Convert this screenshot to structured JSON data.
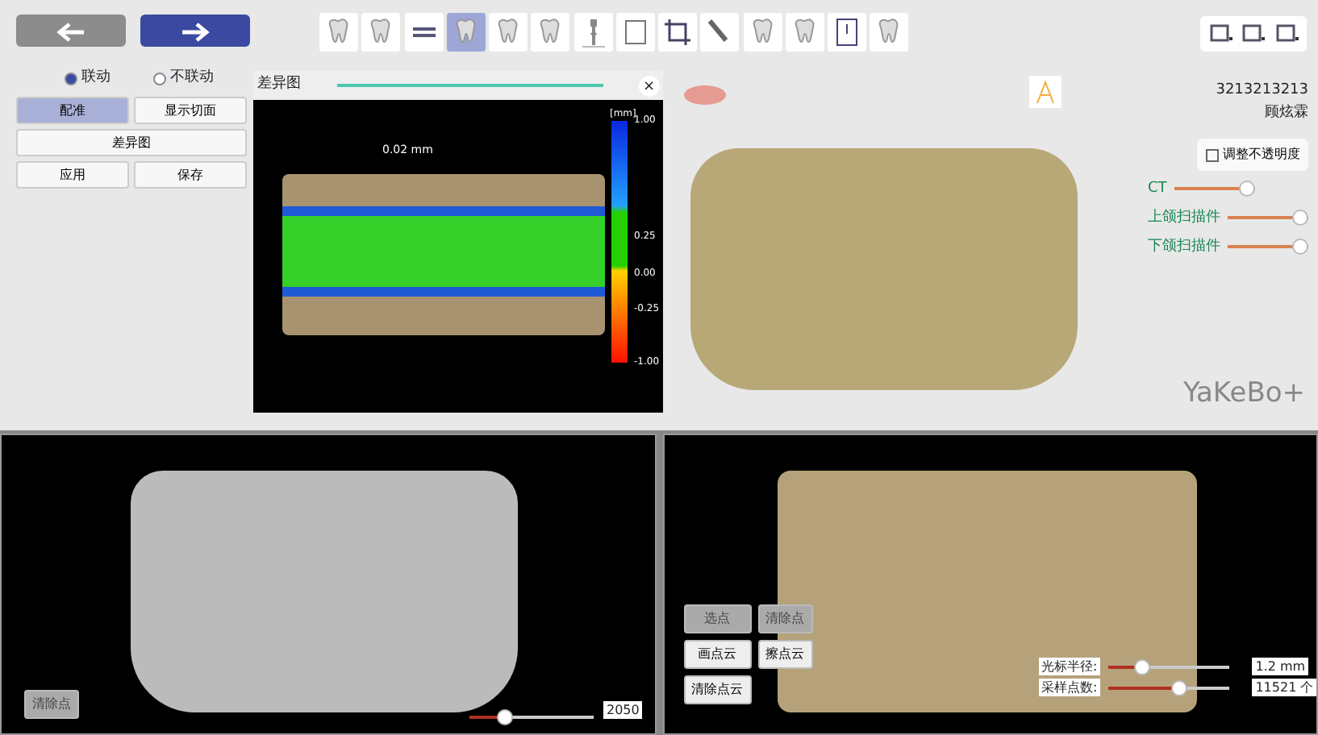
{
  "nav_buttons": [
    {
      "kind": "back",
      "selected": false
    },
    {
      "kind": "forward",
      "selected": true
    }
  ],
  "toolbar": [
    {
      "selected": false
    },
    {
      "selected": false
    },
    {
      "selected": false
    },
    {
      "selected": true
    },
    {
      "selected": false
    },
    {
      "selected": false
    },
    {
      "selected": false
    },
    {
      "selected": false
    },
    {
      "selected": false
    },
    {
      "selected": false
    },
    {
      "selected": false
    },
    {
      "selected": false
    },
    {
      "selected": false
    },
    {
      "selected": false
    }
  ],
  "link_mode": [
    {
      "label": "联动",
      "selected": true
    },
    {
      "label": "不联动",
      "selected": false
    }
  ],
  "left_buttons": [
    {
      "label": "配准",
      "selected": true,
      "wide": false
    },
    {
      "label": "显示切面",
      "selected": false,
      "wide": false
    },
    {
      "label": "差异图",
      "selected": false,
      "wide": true
    },
    {
      "label": "应用",
      "selected": false,
      "wide": false
    },
    {
      "label": "保存",
      "selected": false,
      "wide": false
    }
  ],
  "diff_panel": {
    "title": "差异图",
    "close": "×",
    "annotation": "0.02 mm",
    "legend_unit": "[mm]",
    "legend_ticks": [
      "1.00",
      "0.25",
      "0.00",
      "-0.25",
      "-1.00"
    ]
  },
  "patient": {
    "id": "3213213213",
    "name": "顾炫霖"
  },
  "opacity_button": "调整不透明度",
  "layers": [
    {
      "label": "CT",
      "level": 1.0
    },
    {
      "label": "上颌扫描件",
      "level": 1.0
    },
    {
      "label": "下颌扫描件",
      "level": 1.0
    }
  ],
  "logo": "YaKeBo+",
  "ct_view": {
    "button": {
      "label": "清除点",
      "disabled": true
    },
    "threshold": {
      "level": 0.25,
      "value": "2050"
    }
  },
  "scan_view": {
    "buttons": [
      {
        "label": "选点",
        "disabled": true
      },
      {
        "label": "清除点",
        "disabled": true
      },
      {
        "label": "画点云",
        "disabled": false
      },
      {
        "label": "擦点云",
        "disabled": false
      },
      {
        "label": "清除点云",
        "disabled": false
      }
    ],
    "params": [
      {
        "label": "光标半径:",
        "level": 0.25,
        "value": "1.2 mm"
      },
      {
        "label": "采样点数:",
        "level": 0.6,
        "value": "11521 个"
      }
    ]
  }
}
